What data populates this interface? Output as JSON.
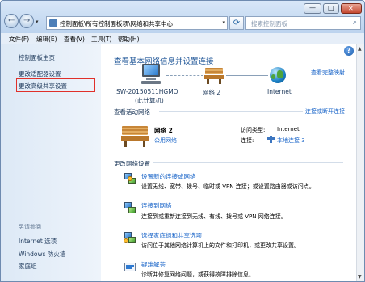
{
  "window": {
    "address_path": "控制面板\\所有控制面板项\\网络和共享中心",
    "search_placeholder": "搜索控制面板",
    "controls": {
      "minimize": "—",
      "maximize": "□",
      "close": "✕"
    }
  },
  "menu": [
    "文件(F)",
    "编辑(E)",
    "查看(V)",
    "工具(T)",
    "帮助(H)"
  ],
  "sidebar": {
    "items": [
      "控制面板主页",
      "更改适配器设置",
      "更改高级共享设置"
    ],
    "see_also_heading": "另请参阅",
    "see_also": [
      "Internet 选项",
      "Windows 防火墙",
      "家庭组"
    ]
  },
  "main": {
    "title": "查看基本网络信息并设置连接",
    "view_full_map": "查看完整映射",
    "map": {
      "computer_name": "SW-20150511HGMO",
      "computer_sub": "(此计算机)",
      "network": "网络  2",
      "internet": "Internet"
    },
    "active_heading": "查看活动网络",
    "connect_link": "连接或断开连接",
    "active": {
      "name": "网络  2",
      "type": "公用网络",
      "access_label": "访问类型:",
      "access_value": "Internet",
      "conn_label": "连接:",
      "conn_value": "本地连接 3"
    },
    "change_heading": "更改网络设置",
    "tasks": [
      {
        "title": "设置新的连接或网络",
        "desc": "设置无线、宽带、拨号、临时或 VPN 连接；或设置路由器或访问点。"
      },
      {
        "title": "连接到网络",
        "desc": "连接到或重新连接到无线、有线、拨号或 VPN 网络连接。"
      },
      {
        "title": "选择家庭组和共享选项",
        "desc": "访问位于其他网络计算机上的文件和打印机，或更改共享设置。"
      },
      {
        "title": "疑难解答",
        "desc": "诊断并修复网络问题，或获得故障排除信息。"
      }
    ]
  },
  "colors": {
    "accent": "#1b66c9",
    "highlight_box": "#e0302a",
    "sidebar_bg": "#dde9f6"
  }
}
